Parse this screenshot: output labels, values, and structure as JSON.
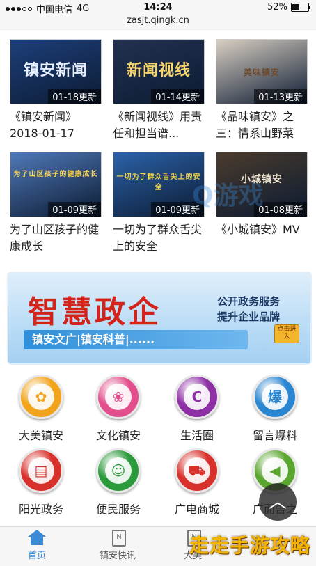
{
  "status": {
    "carrier": "中国电信",
    "network": "4G",
    "time": "14:24",
    "battery": "52%",
    "battery_level": 0.52
  },
  "url": "zasjt.qingk.cn",
  "videos": [
    {
      "thumb_text": "镇安新闻",
      "badge": "01-18更新",
      "title": "《镇安新闻》2018-01-17",
      "bg": "#1d3f7a"
    },
    {
      "thumb_text": "新闻视线",
      "badge": "01-14更新",
      "title": "《新闻视线》用责任和担当谱...",
      "bg": "#22324f"
    },
    {
      "thumb_text": "美味镇安",
      "badge": "01-13更新",
      "title": "《品味镇安》之三：情系山野菜",
      "bg": "#d9cfc2"
    },
    {
      "thumb_text": "为了山区孩子的健康成长",
      "badge": "01-09更新",
      "title": "为了山区孩子的健康成长",
      "bg": "#4f79b8"
    },
    {
      "thumb_text": "一切为了群众舌尖上的安全",
      "badge": "01-09更新",
      "title": "一切为了群众舌尖上的安全",
      "bg": "#2b62a8"
    },
    {
      "thumb_text": "小城镇安",
      "badge": "01-08更新",
      "title": "《小城镇安》MV",
      "bg": "#4a3b2c"
    }
  ],
  "banner": {
    "title": "智慧政企",
    "sub1": "公开政务服务",
    "sub2": "提升企业品牌",
    "strip": "镇安文广|镇安科普|......",
    "button": "点击进入"
  },
  "icons": [
    {
      "label": "大美镇安",
      "color": "#f2a51c",
      "glyph": "✿"
    },
    {
      "label": "文化镇安",
      "color": "#e34e8c",
      "glyph": "❀"
    },
    {
      "label": "生活圈",
      "color": "#8e2fa6",
      "glyph": "C"
    },
    {
      "label": "留言爆料",
      "color": "#2b86d1",
      "glyph": "爆"
    },
    {
      "label": "阳光政务",
      "color": "#d8302a",
      "glyph": "▤"
    },
    {
      "label": "便民服务",
      "color": "#2a9a3a",
      "glyph": "☺"
    },
    {
      "label": "广电商城",
      "color": "#d8302a",
      "glyph": "⛟"
    },
    {
      "label": "广而告之",
      "color": "#5aa62f",
      "glyph": "◀"
    }
  ],
  "nav": [
    {
      "label": "首页"
    },
    {
      "label": "镇安快讯"
    },
    {
      "label": "大美"
    }
  ],
  "watermark": "走走手游攻略",
  "watermark2": "Q游戏"
}
